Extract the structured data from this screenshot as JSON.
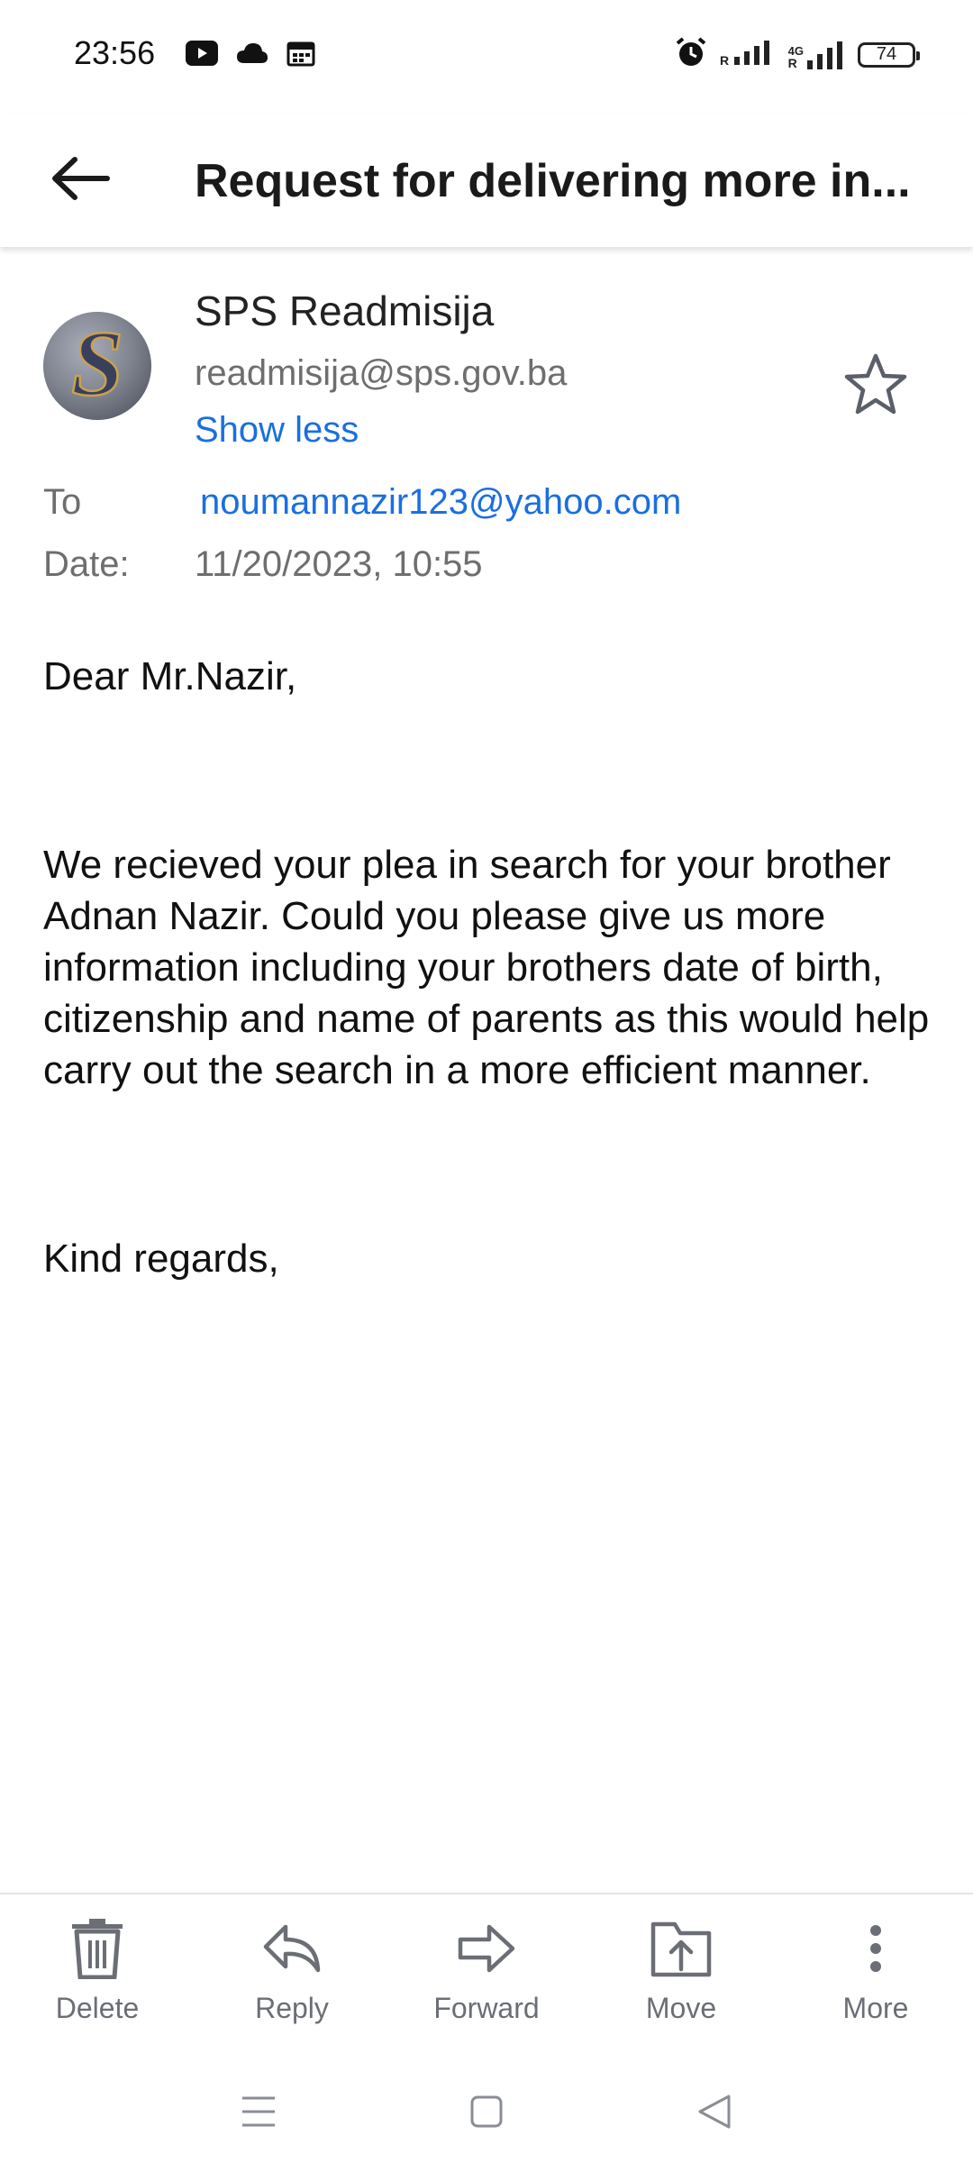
{
  "status_bar": {
    "time": "23:56",
    "network_label": "4G",
    "battery": "74",
    "left_icons": [
      "youtube-icon",
      "cloud-icon",
      "calendar-icon"
    ],
    "right_icons": [
      "alarm-icon",
      "signal-icon",
      "signal-4g-icon",
      "battery-icon"
    ]
  },
  "header": {
    "subject": "Request for delivering more in..."
  },
  "sender": {
    "avatar_letter": "S",
    "name": "SPS Readmisija",
    "email": "readmisija@sps.gov.ba",
    "toggle_label": "Show less"
  },
  "meta": {
    "to_label": "To",
    "to_value": "noumannazir123@yahoo.com",
    "date_label": "Date:",
    "date_value": "11/20/2023, 10:55"
  },
  "body": {
    "greeting": "Dear Mr.Nazir,",
    "paragraph": "We recieved your plea in search for your brother Adnan Nazir. Could you please give us more information including your brothers date of birth, citizenship and name of parents as this would help carry out the search in a more efficient manner.",
    "closing": "Kind regards,"
  },
  "actions": [
    {
      "label": "Delete",
      "icon": "trash-icon"
    },
    {
      "label": "Reply",
      "icon": "reply-icon"
    },
    {
      "label": "Forward",
      "icon": "forward-icon"
    },
    {
      "label": "Move",
      "icon": "move-folder-icon"
    },
    {
      "label": "More",
      "icon": "more-vertical-icon"
    }
  ],
  "colors": {
    "link": "#1a6fe0",
    "muted": "#6e6e6e",
    "icon_gray": "#6b6e75"
  }
}
